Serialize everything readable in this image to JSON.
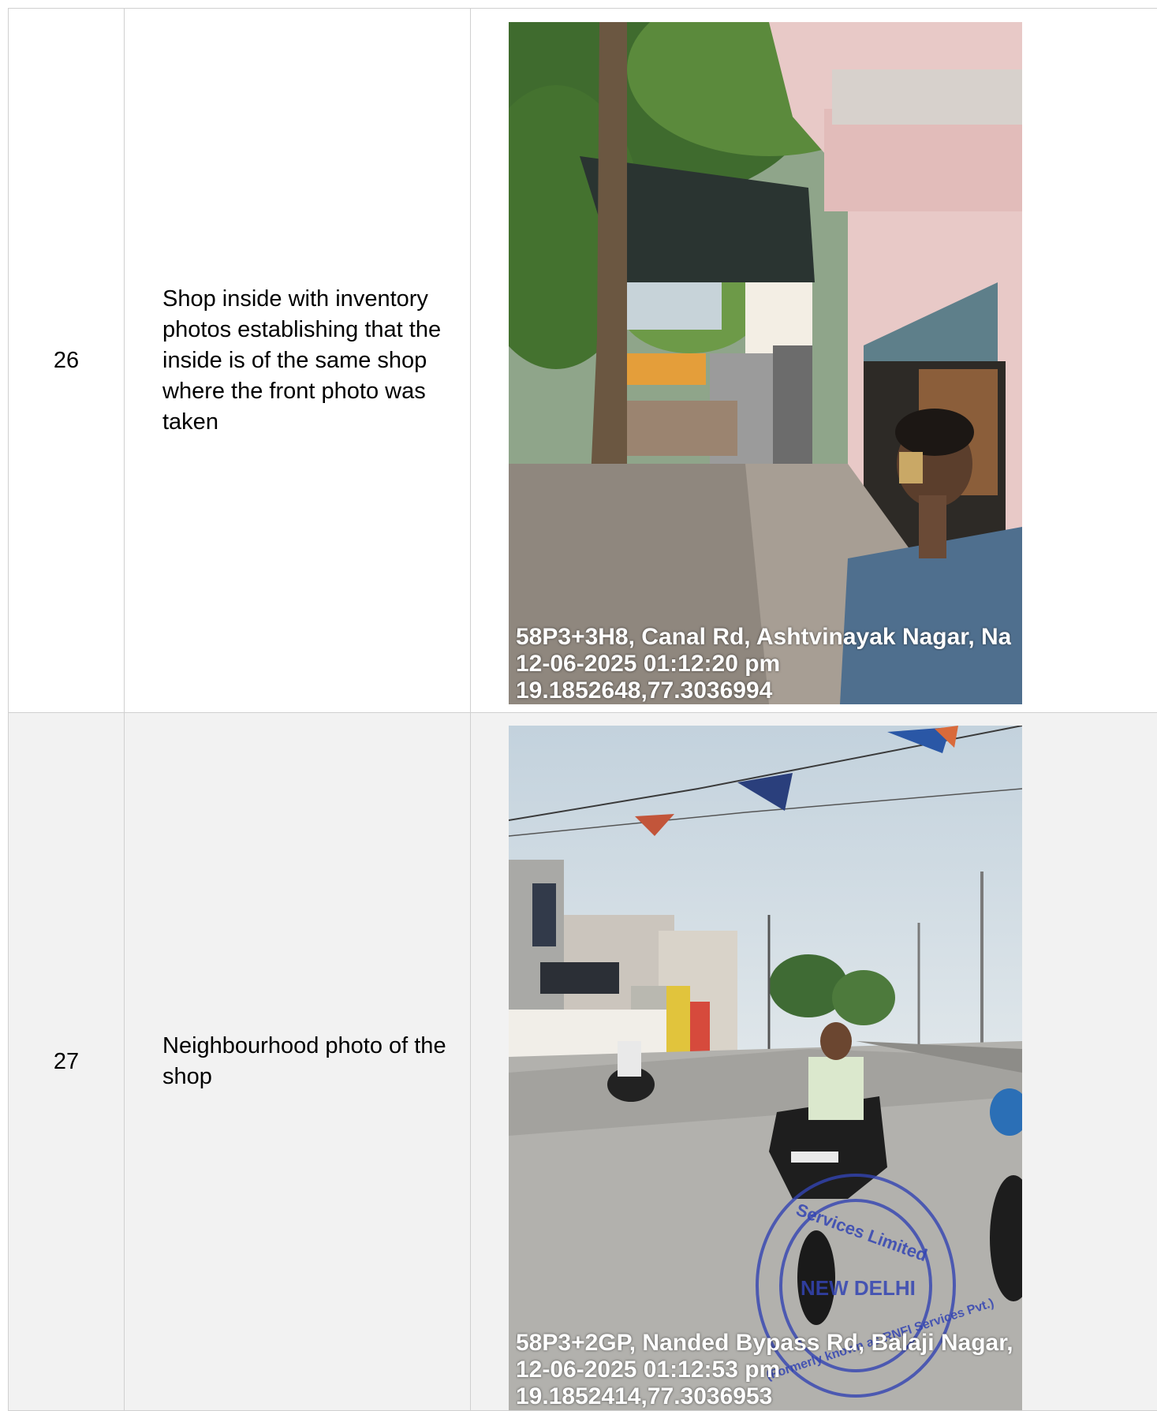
{
  "rows": [
    {
      "number": "26",
      "description": "Shop inside with inventory photos establishing that the inside is of the same shop where the front photo was taken",
      "photo": {
        "address": "58P3+3H8, Canal Rd, Ashtvinayak Nagar, Na",
        "datetime": "12-06-2025 01:12:20 pm",
        "coordinates": "19.1852648,77.3036994"
      }
    },
    {
      "number": "27",
      "description": "Neighbourhood photo of the shop",
      "photo": {
        "address": "58P3+2GP, Nanded Bypass Rd, Balaji Nagar,",
        "datetime": "12-06-2025 01:12:53 pm",
        "coordinates": "19.1852414,77.3036953",
        "stamp_city": "NEW DELHI",
        "stamp_top": "Services Limited",
        "stamp_bottom": "(Formerly known as RNFI Services Pvt.)"
      }
    }
  ]
}
